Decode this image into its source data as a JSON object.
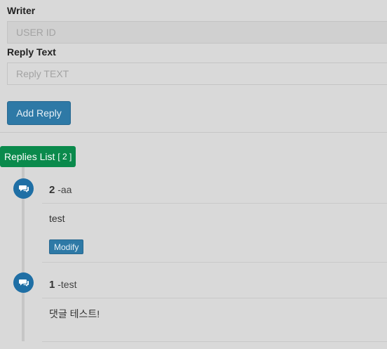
{
  "form": {
    "writer_label": "Writer",
    "writer_placeholder": "USER ID",
    "reply_label": "Reply Text",
    "reply_placeholder": "Reply TEXT",
    "add_button": "Add Reply"
  },
  "replies": {
    "title": "Replies List",
    "count": "[ 2 ]",
    "items": [
      {
        "number": "2",
        "writer": " -aa",
        "text": "test",
        "action": "Modify"
      },
      {
        "number": "1",
        "writer": " -test",
        "text": "댓글 테스트!"
      }
    ]
  },
  "icons": {
    "reply": "comment-icon"
  },
  "colors": {
    "primary": "#2e79a6",
    "success": "#0a8a4c"
  }
}
